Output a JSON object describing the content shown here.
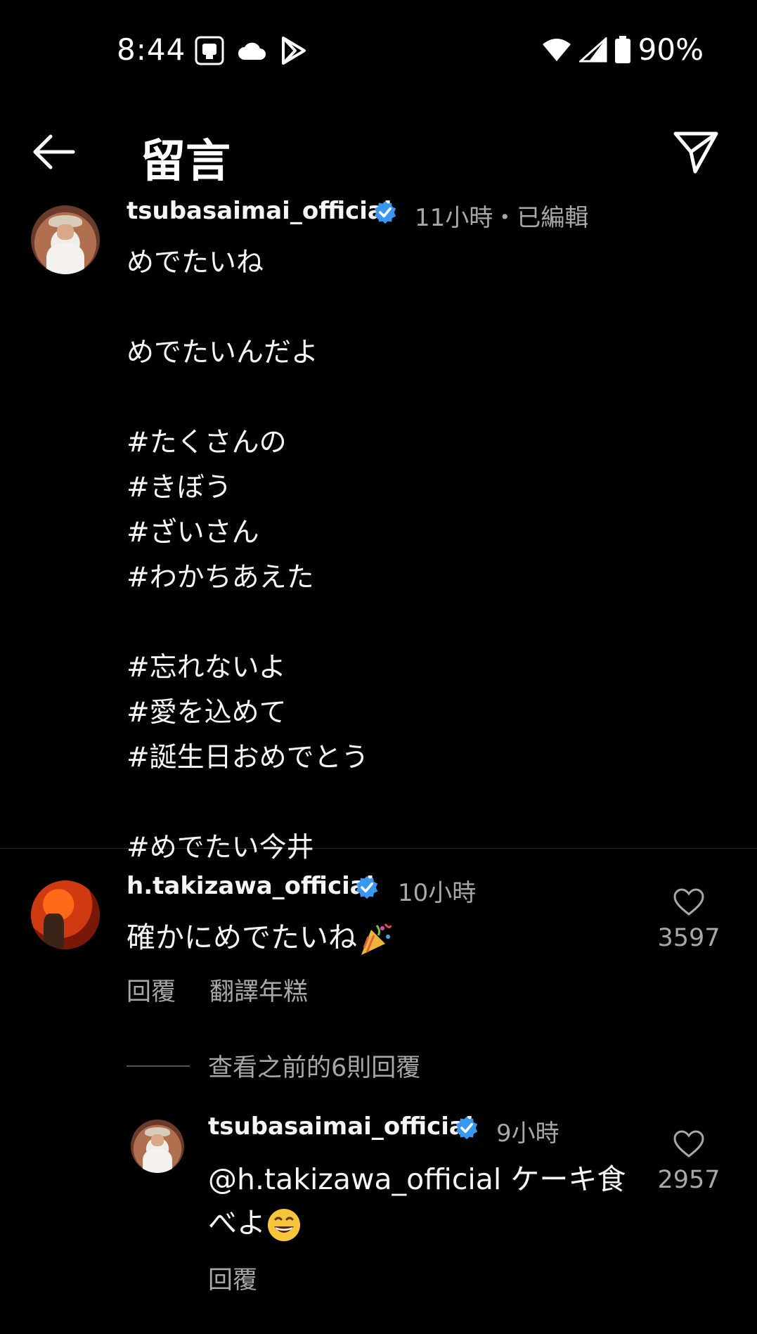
{
  "status_bar": {
    "time": "8:44",
    "battery": "90%"
  },
  "header": {
    "title": "留言"
  },
  "caption": {
    "username": "tsubasaimai_official",
    "meta": "11小時・已編輯",
    "text": "めでたいね\n\nめでたいんだよ\n\n#たくさんの\n#きぼう\n#ざいさん\n#わかちあえた\n\n#忘れないよ\n#愛を込めて\n#誕生日おめでとう\n\n#めでたい今井"
  },
  "comment": {
    "username": "h.takizawa_official",
    "meta": "10小時",
    "text": "確かにめでたいね",
    "reply_label": "回覆",
    "translate_label": "翻譯年糕",
    "likes": "3597"
  },
  "view_replies": "查看之前的6則回覆",
  "reply": {
    "username": "tsubasaimai_official",
    "meta": "9小時",
    "text_line1": "@h.takizawa_official ケーキ食",
    "text_line2": "べよ",
    "reply_label": "回覆",
    "likes": "2957"
  },
  "colors": {
    "background": "#000000",
    "verified": "#3897f0",
    "secondary_text": "#a8a8a8"
  }
}
